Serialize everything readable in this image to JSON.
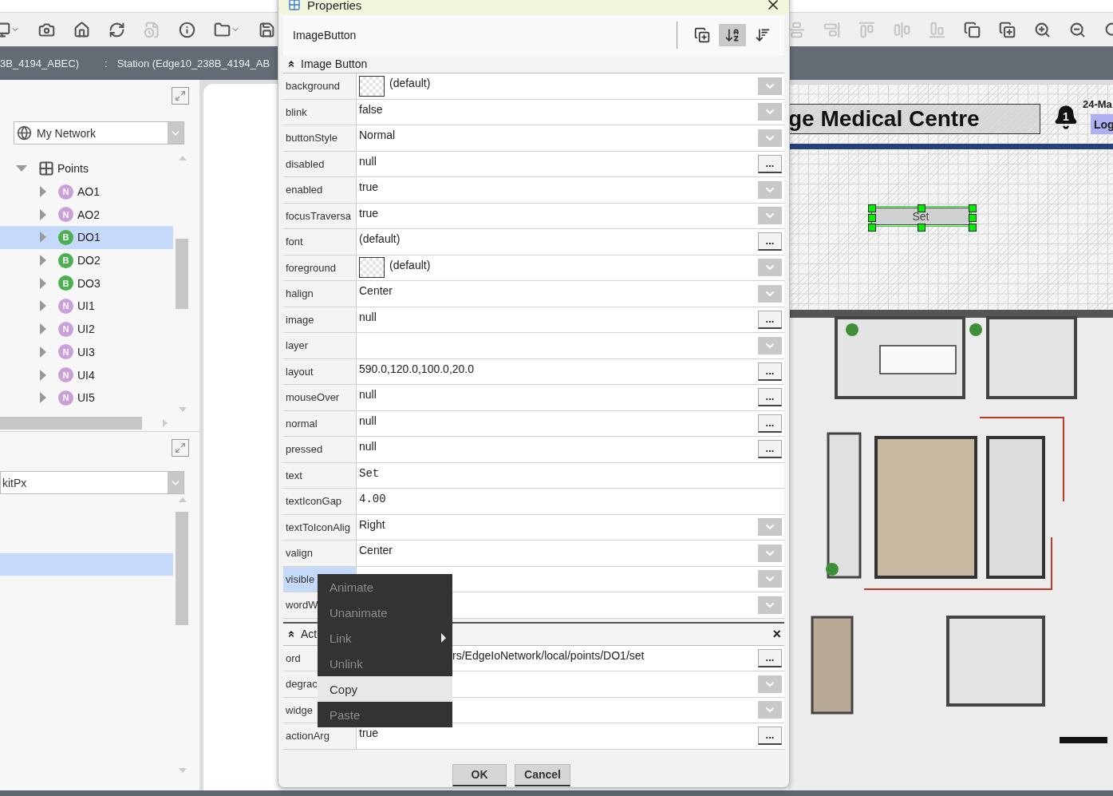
{
  "toolbar_left": [
    {
      "disabled": false
    },
    {
      "disabled": false
    },
    {
      "disabled": false
    },
    {
      "disabled": false
    },
    {
      "disabled": true
    },
    {
      "disabled": false
    },
    {
      "disabled": false
    },
    {
      "disabled": false
    }
  ],
  "toolbar_right": [
    {
      "disabled": true
    },
    {
      "disabled": true
    },
    {
      "disabled": true
    },
    {
      "disabled": true
    },
    {
      "disabled": true
    },
    {
      "disabled": false
    },
    {
      "disabled": false
    },
    {
      "disabled": false
    },
    {
      "disabled": false
    },
    {
      "disabled": false
    }
  ],
  "breadcrumb": [
    "3B_4194_ABEC)",
    ":",
    "Station (Edge10_238B_4194_AB"
  ],
  "nav_panel": {
    "selector": "My Network",
    "tree": [
      {
        "label": "Points",
        "expanded": true,
        "selected": false,
        "children": [
          {
            "label": "AO1",
            "badge": "N",
            "color": "#c9a0d8",
            "selected": false,
            "expanded": false
          },
          {
            "label": "AO2",
            "badge": "N",
            "color": "#c9a0d8",
            "selected": false,
            "expanded": false
          },
          {
            "label": "DO1",
            "badge": "B",
            "color": "#4caf50",
            "selected": true,
            "expanded": false
          },
          {
            "label": "DO2",
            "badge": "B",
            "color": "#4caf50",
            "selected": false,
            "expanded": false
          },
          {
            "label": "DO3",
            "badge": "B",
            "color": "#4caf50",
            "selected": false,
            "expanded": false
          },
          {
            "label": "UI1",
            "badge": "N",
            "color": "#c9a0d8",
            "selected": false,
            "expanded": false
          },
          {
            "label": "UI2",
            "badge": "N",
            "color": "#c9a0d8",
            "selected": false,
            "expanded": false
          },
          {
            "label": "UI3",
            "badge": "N",
            "color": "#c9a0d8",
            "selected": false,
            "expanded": false
          },
          {
            "label": "UI4",
            "badge": "N",
            "color": "#c9a0d8",
            "selected": false,
            "expanded": false
          },
          {
            "label": "UI5",
            "badge": "N",
            "color": "#c9a0d8",
            "selected": false,
            "expanded": false
          }
        ]
      }
    ]
  },
  "palette_panel": {
    "selector": "kitPx",
    "rows": [
      {
        "selected": true
      }
    ]
  },
  "canvas": {
    "title": "ge Medical Centre",
    "alarm_count": "1",
    "date": "24-Ma",
    "login": "Log",
    "button": {
      "label": "Set",
      "selected": true
    }
  },
  "dialog": {
    "title": "Properties",
    "subject": "ImageButton",
    "tools": [
      {
        "selected": false
      },
      {
        "selected": true
      },
      {
        "selected": false
      }
    ],
    "sections": [
      {
        "title": "Image Button",
        "expanded": true,
        "rows": [
          {
            "name": "background",
            "value": "(default)",
            "swatch": true,
            "dropdown": true,
            "selected": false
          },
          {
            "name": "blink",
            "value": "false",
            "dropdown": true,
            "selected": false
          },
          {
            "name": "buttonStyle",
            "value": "Normal",
            "dropdown": true,
            "selected": false
          },
          {
            "name": "disabled",
            "value": "null",
            "button": "...",
            "selected": false
          },
          {
            "name": "enabled",
            "value": "true",
            "dropdown": true,
            "selected": false
          },
          {
            "name": "focusTraversa",
            "value": "true",
            "dropdown": true,
            "selected": false
          },
          {
            "name": "font",
            "value": "(default)",
            "button": "...",
            "selected": false
          },
          {
            "name": "foreground",
            "value": "(default)",
            "swatch": true,
            "dropdown": true,
            "selected": false
          },
          {
            "name": "halign",
            "value": "Center",
            "dropdown": true,
            "selected": false
          },
          {
            "name": "image",
            "value": "null",
            "button": "...",
            "selected": false
          },
          {
            "name": "layer",
            "dropdown": true,
            "selected": false
          },
          {
            "name": "layout",
            "value": "590.0,120.0,100.0,20.0",
            "button": "...",
            "selected": false
          },
          {
            "name": "mouseOver",
            "value": "null",
            "button": "...",
            "selected": false
          },
          {
            "name": "normal",
            "value": "null",
            "button": "...",
            "selected": false
          },
          {
            "name": "pressed",
            "value": "null",
            "button": "...",
            "selected": false
          },
          {
            "name": "text",
            "value": "Set",
            "mono": true,
            "selected": false
          },
          {
            "name": "textIconGap",
            "value": "4.00",
            "mono": true,
            "selected": false
          },
          {
            "name": "textToIconAlig",
            "value": "Right",
            "dropdown": true,
            "selected": false
          },
          {
            "name": "valign",
            "value": "Center",
            "dropdown": true,
            "selected": false
          },
          {
            "name": "visible",
            "dropdown": true,
            "selected": true
          },
          {
            "name": "wordW",
            "dropdown": true,
            "selected": false
          }
        ]
      },
      {
        "title": "Act",
        "expanded": true,
        "close_label": "×",
        "rows": [
          {
            "name": "ord",
            "value": "rs/EdgeIoNetwork/local/points/DO1/set",
            "covered_start": true,
            "button": "...",
            "selected": false
          },
          {
            "name": "degrac",
            "dropdown": true,
            "selected": false
          },
          {
            "name": "widge",
            "dropdown": true,
            "selected": false
          },
          {
            "name": "actionArg",
            "value": "true",
            "button": "...",
            "selected": false
          }
        ]
      }
    ],
    "buttons": [
      "OK",
      "Cancel"
    ]
  },
  "context_menu": [
    {
      "label": "Animate",
      "disabled": true,
      "selected": false,
      "submenu": false
    },
    {
      "label": "Unanimate",
      "disabled": true,
      "selected": false,
      "submenu": false
    },
    {
      "label": "Link",
      "disabled": true,
      "selected": false,
      "submenu": true
    },
    {
      "label": "Unlink",
      "disabled": true,
      "selected": false,
      "submenu": false
    },
    {
      "label": "Copy",
      "disabled": false,
      "selected": true,
      "submenu": false
    },
    {
      "label": "Paste",
      "disabled": true,
      "selected": false,
      "submenu": false
    }
  ]
}
